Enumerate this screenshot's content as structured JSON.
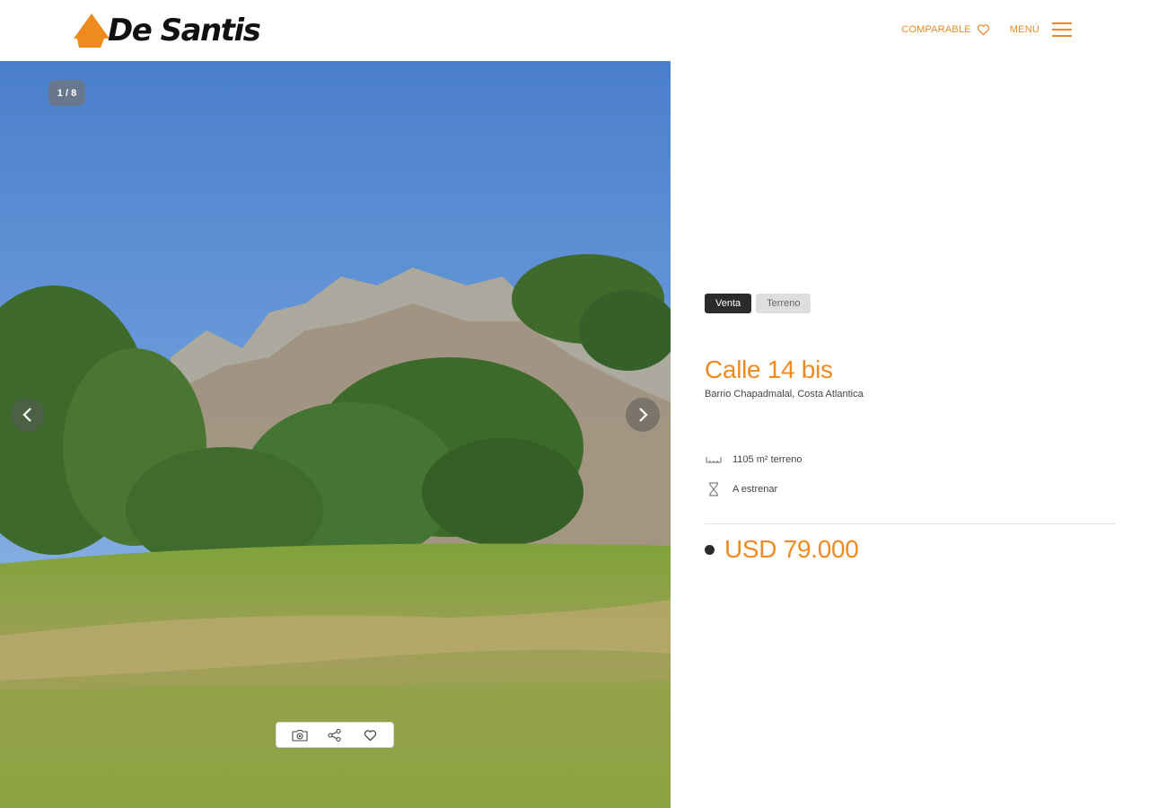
{
  "header": {
    "brand": "De Santis",
    "nav": {
      "comparable_label": "COMPARABLE",
      "menu_label": "MENÚ"
    }
  },
  "gallery": {
    "counter": "1 / 8"
  },
  "listing": {
    "tags": [
      "Venta",
      "Terreno"
    ],
    "title": "Calle 14 bis",
    "location": "Barrio Chapadmalal, Costa Atlantica",
    "features": [
      {
        "icon": "ruler-icon",
        "text": "1105 m² terreno"
      },
      {
        "icon": "hourglass-icon",
        "text": "A estrenar"
      }
    ],
    "price": "USD 79.000"
  },
  "colors": {
    "accent": "#ef8a1f",
    "dark": "#2b2b2b"
  }
}
